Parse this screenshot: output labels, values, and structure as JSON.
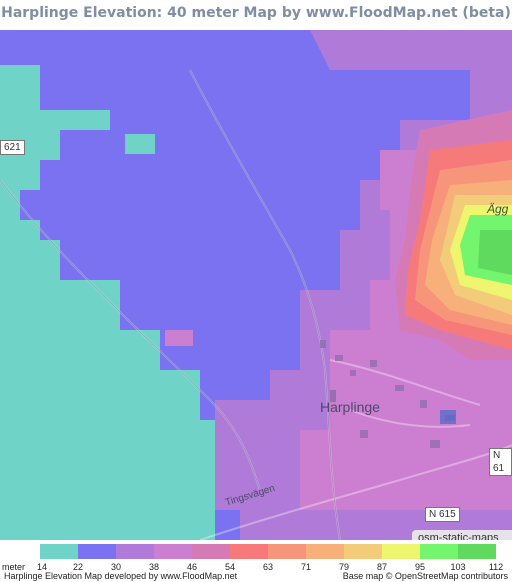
{
  "title": "Harplinge Elevation: 40 meter Map by www.FloodMap.net (beta)",
  "map": {
    "town_label": "Harplinge",
    "place_label": "Ägg",
    "street_label": "Tingsvägen",
    "road_shields": [
      "621",
      "N 61",
      "N 615"
    ],
    "attribution": "osm-static-maps"
  },
  "legend": {
    "unit": "meter",
    "ticks": [
      "14",
      "22",
      "30",
      "38",
      "46",
      "54",
      "63",
      "71",
      "79",
      "87",
      "95",
      "103",
      "112"
    ],
    "colors": [
      "#6fd3c8",
      "#7a72f0",
      "#b07ad8",
      "#cc7fd0",
      "#d67ab6",
      "#f67a7a",
      "#f7957a",
      "#f7b07a",
      "#f3cc7a",
      "#eef56e",
      "#74f56e",
      "#5fda5f"
    ]
  },
  "footer": {
    "left": "Harplinge Elevation Map developed by www.FloodMap.net",
    "right": "Base map © OpenStreetMap contributors"
  }
}
